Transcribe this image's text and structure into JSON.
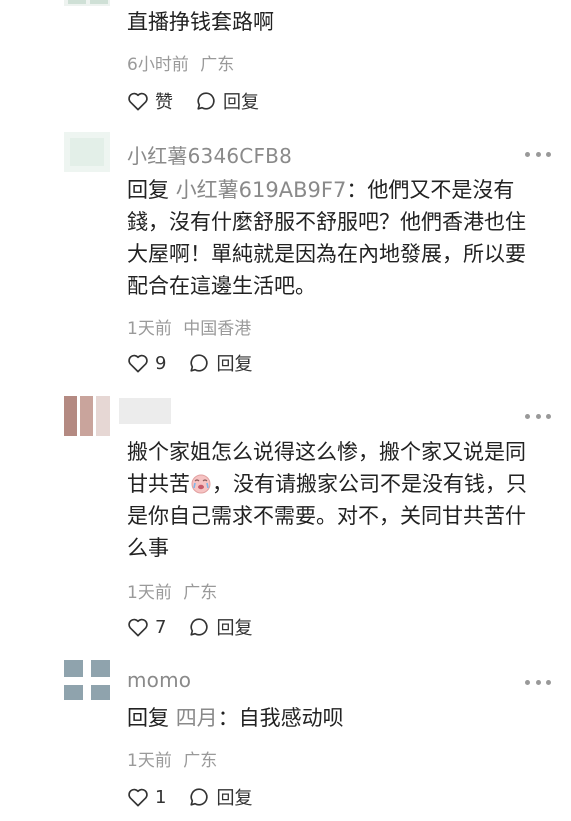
{
  "comments": [
    {
      "text": "直播挣钱套路啊",
      "time": "6小时前",
      "location": "广东",
      "like_label": "赞",
      "reply_label": "回复"
    },
    {
      "username": "小红薯6346CFB8",
      "reply_prefix": "回复",
      "reply_to": "小红薯619AB9F7",
      "text_lines": [
        "：他們又不是沒有",
        "錢，沒有什麼舒服不舒服吧？他們香港也住",
        "大屋啊！單純就是因為在內地發展，所以要",
        "配合在這邊生活吧。"
      ],
      "time": "1天前",
      "location": "中国香港",
      "like_count": "9",
      "reply_label": "回复"
    },
    {
      "text_lines": [
        "搬个家姐怎么说得这么惨，搬个家又说是同",
        "甘共苦",
        "，没有请搬家公司不是没有钱，只",
        "是你自己需求不需要。对不，关同甘共苦什",
        "么事"
      ],
      "emoji": "crying-face-emoji",
      "time": "1天前",
      "location": "广东",
      "like_count": "7",
      "reply_label": "回复"
    },
    {
      "username": "momo",
      "reply_prefix": "回复",
      "reply_to": "四月",
      "text": "：自我感动呗",
      "time": "1天前",
      "location": "广东",
      "like_count": "1",
      "reply_label": "回复"
    }
  ],
  "colors": {
    "background": "#ffffff",
    "text": "#222222",
    "secondary": "#8a8a8a",
    "meta": "#9a9a9a"
  }
}
